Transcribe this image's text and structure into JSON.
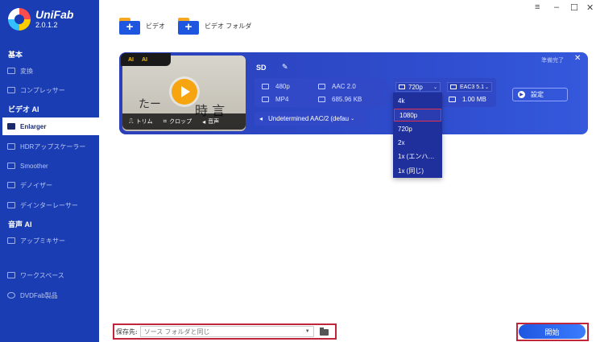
{
  "app": {
    "name": "UniFab",
    "version": "2.0.1.2"
  },
  "colors": {
    "sidebar": "#1a3db4",
    "card": "#2e4ccc",
    "accent": "#f6a410",
    "highlight": "#e0304a"
  },
  "sidebar": {
    "section_basic": "基本",
    "convert": "変換",
    "compressor": "コンプレッサー",
    "section_video_ai": "ビデオ AI",
    "enlarger": "Enlarger",
    "hdr": "HDRアップスケーラー",
    "smoother": "Smoother",
    "denoise": "デノイザー",
    "deinterlace": "デインターレーサー",
    "section_audio_ai": "音声 AI",
    "upmix": "アップミキサー",
    "workspace": "ワークスペース",
    "dvdfab": "DVDFab製品"
  },
  "window": {
    "menu_icon": "≡",
    "minimize": "–",
    "maximize": "☐",
    "close": "✕"
  },
  "toolbar": {
    "add_video": "ビデオ",
    "add_folder": "ビデオ フォルダ"
  },
  "task": {
    "badge_video": "AI",
    "badge_audio": "AI",
    "trim": "トリム",
    "crop": "クロップ",
    "audio": "音声",
    "title": "SD",
    "status": "準備完了",
    "src_res": "480p",
    "src_audio": "AAC 2.0",
    "src_format": "MP4",
    "src_size": "685.96 KB",
    "out_res": "720p",
    "out_audio": "EAC3 5.1",
    "out_size": "1.00 MB",
    "settings": "設定",
    "audio_track": "Undetermined AAC/2 (defau"
  },
  "resolution_dropdown": {
    "options": [
      "4k",
      "1080p",
      "720p",
      "2x",
      "1x (エンハ…",
      "1x (同じ)"
    ],
    "highlighted": "1080p"
  },
  "footer": {
    "save_label": "保存先:",
    "save_path": "ソース フォルダと同じ",
    "start": "開始"
  }
}
